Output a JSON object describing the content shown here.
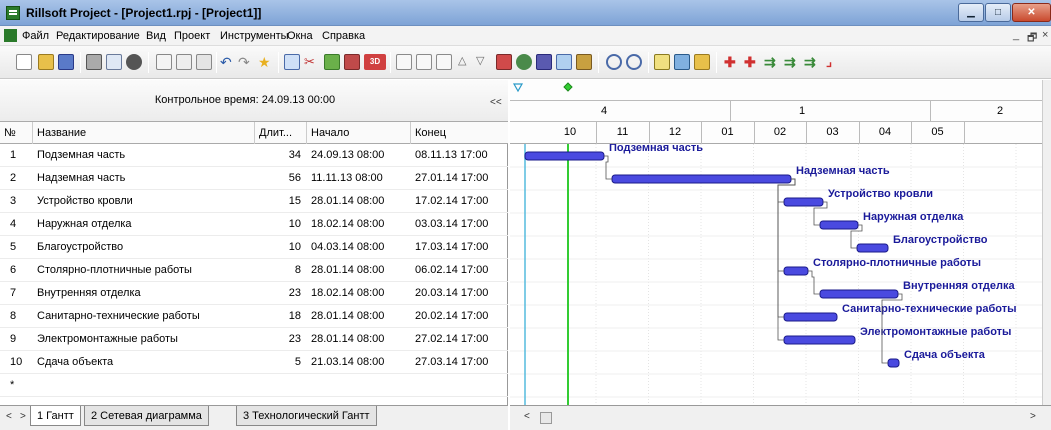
{
  "window": {
    "title": "Rillsoft Project - [Project1.rpj - [Project1]]",
    "minimize_icon": "minimize-icon",
    "maximize_icon": "maximize-icon",
    "close_icon": "close-icon"
  },
  "menu": {
    "items": [
      "Файл",
      "Редактирование",
      "Вид",
      "Проект",
      "Инструменты",
      "Окна",
      "Справка"
    ],
    "mdi_controls": [
      "_",
      "🗗",
      "×"
    ]
  },
  "toolbar": {
    "icons": [
      "new-icon",
      "open-icon",
      "save-icon",
      "print-icon",
      "print-preview-icon",
      "find-icon",
      "cut-icon",
      "copy-icon",
      "paste-icon",
      "undo-icon",
      "redo-icon",
      "star-icon",
      "link-icon",
      "unlink-icon",
      "outdent-icon",
      "indent-icon",
      "3d-icon",
      "task-icon",
      "task-icon",
      "task-icon",
      "move-up-icon",
      "move-down-icon",
      "add-task-icon",
      "add-milestone-icon",
      "add-resource-icon",
      "calendar-icon",
      "filter-icon",
      "zoom-in-icon",
      "zoom-out-icon",
      "layout-icon",
      "layout-icon",
      "folder-icon",
      "critical-path-icon",
      "insert-icon",
      "move-icon",
      "move-icon",
      "move-icon",
      "end-icon"
    ]
  },
  "left_panel": {
    "control_time": "Контрольное время: 24.09.13 00:00",
    "collapse_label": "<<",
    "columns": [
      "№",
      "Название",
      "Длит...",
      "Начало",
      "Конец"
    ],
    "rows": [
      {
        "no": "1",
        "name": "Подземная часть",
        "dur": "34",
        "start": "24.09.13 08:00",
        "end": "08.11.13 17:00"
      },
      {
        "no": "2",
        "name": "Надземная часть",
        "dur": "56",
        "start": "11.11.13 08:00",
        "end": "27.01.14 17:00"
      },
      {
        "no": "3",
        "name": "Устройство кровли",
        "dur": "15",
        "start": "28.01.14 08:00",
        "end": "17.02.14 17:00"
      },
      {
        "no": "4",
        "name": "Наружная отделка",
        "dur": "10",
        "start": "18.02.14 08:00",
        "end": "03.03.14 17:00"
      },
      {
        "no": "5",
        "name": "Благоустройство",
        "dur": "10",
        "start": "04.03.14 08:00",
        "end": "17.03.14 17:00"
      },
      {
        "no": "6",
        "name": "Столярно-плотничные работы",
        "dur": "8",
        "start": "28.01.14 08:00",
        "end": "06.02.14 17:00"
      },
      {
        "no": "7",
        "name": "Внутренняя отделка",
        "dur": "23",
        "start": "18.02.14 08:00",
        "end": "20.03.14 17:00"
      },
      {
        "no": "8",
        "name": "Санитарно-технические работы",
        "dur": "18",
        "start": "28.01.14 08:00",
        "end": "20.02.14 17:00"
      },
      {
        "no": "9",
        "name": "Электромонтажные работы",
        "dur": "23",
        "start": "28.01.14 08:00",
        "end": "27.02.14 17:00"
      },
      {
        "no": "10",
        "name": "Сдача объекта",
        "dur": "5",
        "start": "21.03.14 08:00",
        "end": "27.03.14 17:00"
      },
      {
        "no": "*",
        "name": "",
        "dur": "",
        "start": "",
        "end": ""
      }
    ]
  },
  "gantt": {
    "markers": [
      "triangle-marker-icon",
      "diamond-marker-icon"
    ],
    "quarters": [
      "4",
      "1",
      "2"
    ],
    "months": [
      "10",
      "11",
      "12",
      "01",
      "02",
      "03",
      "04",
      "05"
    ],
    "bar_labels": [
      "Подземная часть",
      "Надземная часть",
      "Устройство кровли",
      "Наружная отделка",
      "Благоустройство",
      "Столярно-плотничные работы",
      "Внутренняя отделка",
      "Санитарно-технические работы",
      "Электромонтажные работы",
      "Сдача объекта"
    ],
    "colors": {
      "bar": "#4a4ae0",
      "label": "#1a1a9a",
      "control_line": "#33cc33",
      "today_line": "#55bbdd"
    }
  },
  "tabs": [
    "1 Гантт",
    "2 Сетевая диаграмма",
    "3 Технологический Гантт"
  ],
  "nav": {
    "left": "<",
    "right": ">"
  },
  "hscroll": {
    "left": "<",
    "right": ">"
  }
}
